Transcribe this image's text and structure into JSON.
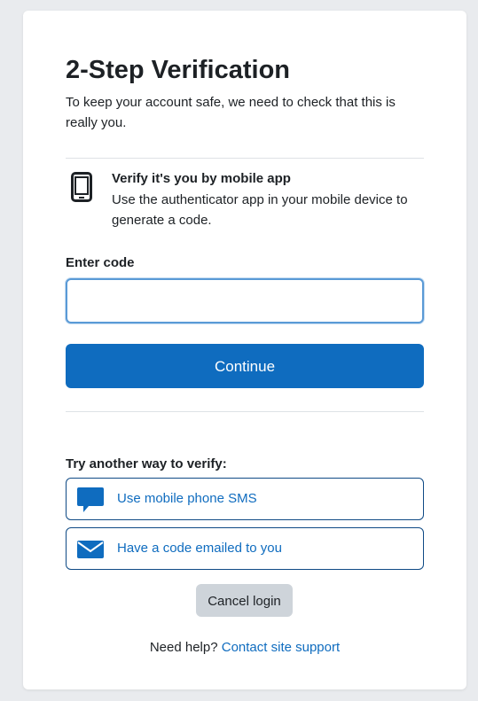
{
  "page": {
    "title": "2-Step Verification",
    "subtitle": "To keep your account safe, we need to check that this is really you."
  },
  "method": {
    "icon": "mobile-phone-icon",
    "title": "Verify it's you by mobile app",
    "description": "Use the authenticator app in your mobile device to generate a code."
  },
  "form": {
    "code_label": "Enter code",
    "code_value": "",
    "continue_label": "Continue"
  },
  "alternatives": {
    "title": "Try another way to verify:",
    "options": [
      {
        "icon": "sms-chat-icon",
        "label": "Use mobile phone SMS"
      },
      {
        "icon": "envelope-icon",
        "label": "Have a code emailed to you"
      }
    ]
  },
  "cancel_label": "Cancel login",
  "help": {
    "prefix": "Need help?",
    "link_label": "Contact site support"
  },
  "colors": {
    "primary": "#0f6cbf",
    "secondary_button": "#ced4da",
    "background": "#e9ebee"
  }
}
